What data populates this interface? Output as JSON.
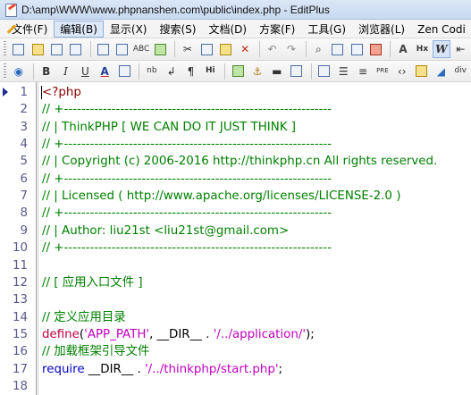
{
  "window": {
    "title": "D:\\amp\\WWW\\www.phpnanshen.com\\public\\index.php - EditPlus"
  },
  "menu": [
    {
      "label": "文件(F)"
    },
    {
      "label": "编辑(B)"
    },
    {
      "label": "显示(X)"
    },
    {
      "label": "搜索(S)"
    },
    {
      "label": "文档(D)"
    },
    {
      "label": "方案(F)"
    },
    {
      "label": "工具(G)"
    },
    {
      "label": "浏览器(L)"
    },
    {
      "label": "Zen Codi"
    }
  ],
  "toolbar_two": {
    "bold": "B",
    "italic": "I",
    "underline": "U",
    "font_color": "A",
    "nbsp": "nb",
    "line_break": "↲",
    "paragraph": "¶",
    "heading": "Hi",
    "pre": "PRE",
    "hx": "Hx",
    "div": "div"
  },
  "editor": {
    "lines": [
      {
        "num": "1",
        "spans": [
          {
            "cls": "c-tag",
            "text": "<?php"
          }
        ]
      },
      {
        "num": "2",
        "spans": [
          {
            "cls": "c-comment",
            "text": "// +--------------------------------------------------------------"
          }
        ]
      },
      {
        "num": "3",
        "spans": [
          {
            "cls": "c-comment",
            "text": "// | ThinkPHP [ WE CAN DO IT JUST THINK ]"
          }
        ]
      },
      {
        "num": "4",
        "spans": [
          {
            "cls": "c-comment",
            "text": "// +--------------------------------------------------------------"
          }
        ]
      },
      {
        "num": "5",
        "spans": [
          {
            "cls": "c-comment",
            "text": "// | Copyright (c) 2006-2016 http://thinkphp.cn All rights reserved."
          }
        ]
      },
      {
        "num": "6",
        "spans": [
          {
            "cls": "c-comment",
            "text": "// +--------------------------------------------------------------"
          }
        ]
      },
      {
        "num": "7",
        "spans": [
          {
            "cls": "c-comment",
            "text": "// | Licensed ( http://www.apache.org/licenses/LICENSE-2.0 )"
          }
        ]
      },
      {
        "num": "8",
        "spans": [
          {
            "cls": "c-comment",
            "text": "// +--------------------------------------------------------------"
          }
        ]
      },
      {
        "num": "9",
        "spans": [
          {
            "cls": "c-comment",
            "text": "// | Author: liu21st <liu21st@gmail.com>"
          }
        ]
      },
      {
        "num": "10",
        "spans": [
          {
            "cls": "c-comment",
            "text": "// +--------------------------------------------------------------"
          }
        ]
      },
      {
        "num": "11",
        "spans": []
      },
      {
        "num": "12",
        "spans": [
          {
            "cls": "c-comment",
            "text": "// [ 应用入口文件 ]"
          }
        ]
      },
      {
        "num": "13",
        "spans": []
      },
      {
        "num": "14",
        "spans": [
          {
            "cls": "c-comment",
            "text": "// 定义应用目录"
          }
        ]
      },
      {
        "num": "15",
        "spans": [
          {
            "cls": "c-func",
            "text": "define"
          },
          {
            "cls": "c-plain",
            "text": "("
          },
          {
            "cls": "c-str",
            "text": "'APP_PATH'"
          },
          {
            "cls": "c-plain",
            "text": ", __DIR__ . "
          },
          {
            "cls": "c-str",
            "text": "'/../application/'"
          },
          {
            "cls": "c-plain",
            "text": ");"
          }
        ]
      },
      {
        "num": "16",
        "spans": [
          {
            "cls": "c-comment",
            "text": "// 加载框架引导文件"
          }
        ]
      },
      {
        "num": "17",
        "spans": [
          {
            "cls": "c-kw",
            "text": "require"
          },
          {
            "cls": "c-plain",
            "text": " __DIR__ . "
          },
          {
            "cls": "c-str",
            "text": "'/../thinkphp/start.php'"
          },
          {
            "cls": "c-plain",
            "text": ";"
          }
        ]
      },
      {
        "num": "18",
        "spans": []
      }
    ]
  }
}
